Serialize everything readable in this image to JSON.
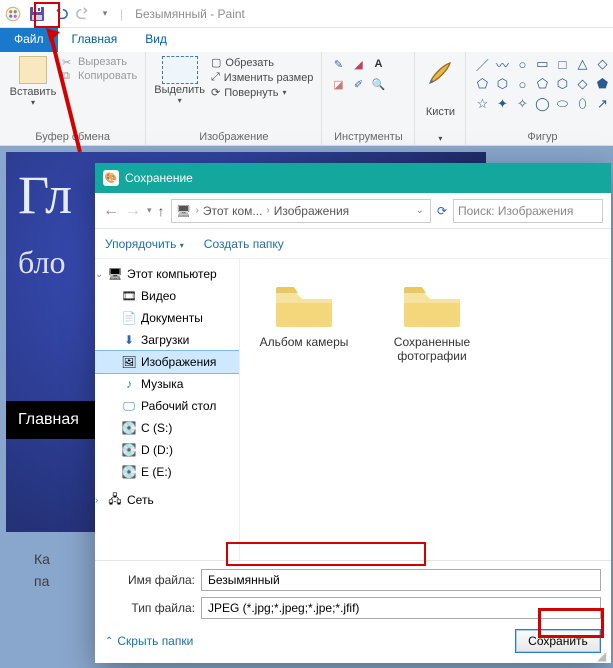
{
  "titlebar": {
    "undo_icon": "undo",
    "redo_icon": "redo",
    "title": "Безымянный - Paint"
  },
  "menu": {
    "file": "Файл",
    "home": "Главная",
    "view": "Вид"
  },
  "ribbon": {
    "clipboard": {
      "paste": "Вставить",
      "cut": "Вырезать",
      "copy": "Копировать",
      "group": "Буфер обмена"
    },
    "image": {
      "select": "Выделить",
      "crop": "Обрезать",
      "resize": "Изменить размер",
      "rotate": "Повернуть",
      "group": "Изображение"
    },
    "tools": {
      "group": "Инструменты"
    },
    "brush": {
      "label": "Кисти"
    },
    "shapes": {
      "group": "Фигур"
    }
  },
  "canvas": {
    "h1": "Гл",
    "h2": "бло",
    "nav_item": "Главная"
  },
  "bottom_lines": {
    "l1": "Ка",
    "l2": "па"
  },
  "dialog": {
    "title": "Сохранение",
    "nav": {
      "crumb1": "Этот ком...",
      "crumb2": "Изображения",
      "search_placeholder": "Поиск: Изображения"
    },
    "toolbar": {
      "organize": "Упорядочить",
      "new_folder": "Создать папку"
    },
    "tree": {
      "this_pc": "Этот компьютер",
      "video": "Видео",
      "documents": "Документы",
      "downloads": "Загрузки",
      "pictures": "Изображения",
      "music": "Музыка",
      "desktop": "Рабочий стол",
      "disk_c": "C (S:)",
      "disk_d": "D (D:)",
      "disk_e": "E (E:)",
      "network": "Сеть"
    },
    "folders": {
      "f1": "Альбом камеры",
      "f2": "Сохраненные фотографии"
    },
    "fields": {
      "name_label": "Имя файла:",
      "name_value": "Безымянный",
      "type_label": "Тип файла:",
      "type_value": "JPEG (*.jpg;*.jpeg;*.jpe;*.jfif)"
    },
    "hide_folders": "Скрыть папки",
    "save_btn": "Сохранить"
  }
}
